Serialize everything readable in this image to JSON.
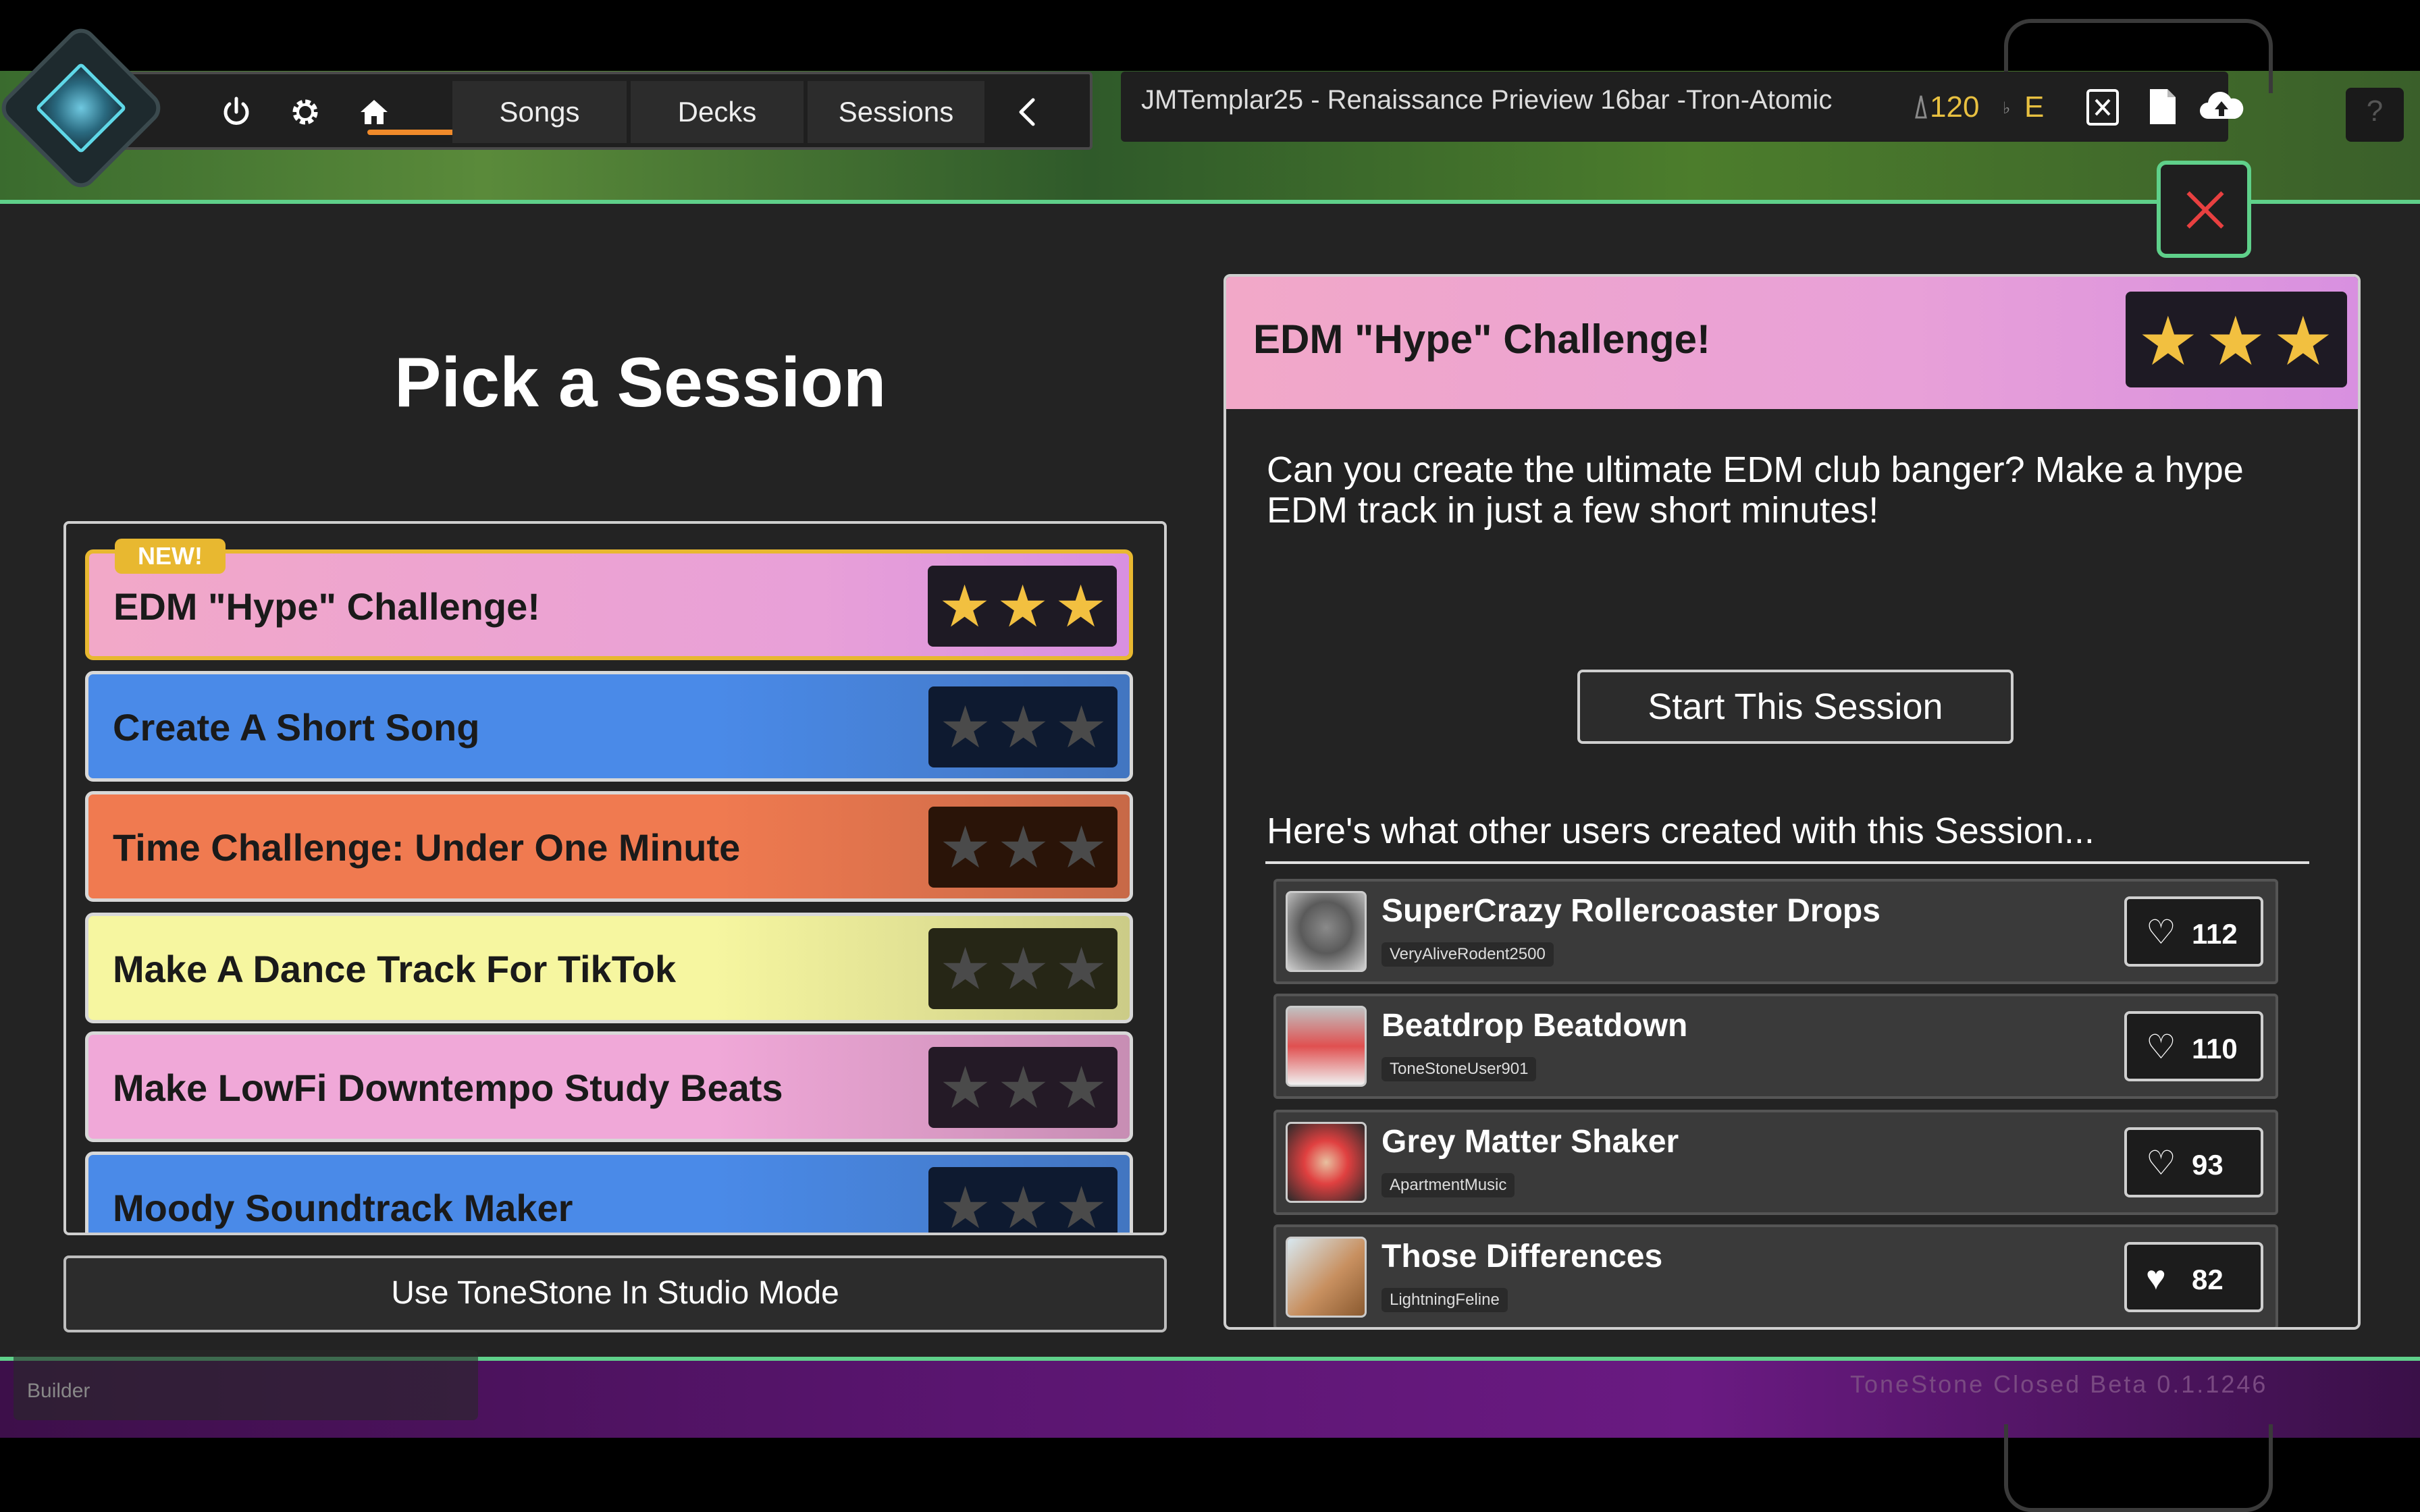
{
  "topbar": {
    "tabs": [
      "Songs",
      "Decks",
      "Sessions"
    ],
    "song_title": "JMTemplar25 - Renaissance Prieview 16bar -Tron-Atomic",
    "bpm": "120",
    "key": "E",
    "help_label": "?"
  },
  "left": {
    "title": "Pick a Session",
    "new_badge": "NEW!",
    "sessions": [
      {
        "label": "EDM \"Hype\" Challenge!",
        "stars_earned": 3,
        "color": "#f0a8d0"
      },
      {
        "label": "Create A Short Song",
        "stars_earned": 0,
        "color": "#4a8ae8"
      },
      {
        "label": "Time Challenge: Under One Minute",
        "stars_earned": 0,
        "color": "#f07a50"
      },
      {
        "label": "Make A Dance Track For TikTok",
        "stars_earned": 0,
        "color": "#f6f6a0"
      },
      {
        "label": "Make LowFi Downtempo Study Beats",
        "stars_earned": 0,
        "color": "#f0a8d8"
      },
      {
        "label": "Moody Soundtrack Maker",
        "stars_earned": 0,
        "color": "#4a8ae8"
      }
    ],
    "studio_button": "Use ToneStone In Studio Mode"
  },
  "detail": {
    "title": "EDM \"Hype\" Challenge!",
    "stars_earned": 3,
    "description": "Can you create the ultimate EDM club banger? Make a hype EDM track in just a few short minutes!",
    "start_button": "Start This Session",
    "others_label": "Here's what other users created with this Session...",
    "entries": [
      {
        "name": "SuperCrazy Rollercoaster Drops",
        "user": "VeryAliveRodent2500",
        "likes": "112",
        "liked": false
      },
      {
        "name": "Beatdrop Beatdown",
        "user": "ToneStoneUser901",
        "likes": "110",
        "liked": false
      },
      {
        "name": "Grey Matter Shaker",
        "user": "ApartmentMusic",
        "likes": "93",
        "liked": false
      },
      {
        "name": "Those Differences",
        "user": "LightningFeline",
        "likes": "82",
        "liked": true
      }
    ]
  },
  "bottombar": {
    "builder_label": "Builder",
    "version": "ToneStone Closed Beta 0.1.1246"
  },
  "colors": {
    "accent_green": "#5fd08a",
    "star_gold": "#f2c040",
    "star_empty": "#4a4a4a",
    "close_red": "#e84040",
    "home_underline": "#f08a2a"
  }
}
